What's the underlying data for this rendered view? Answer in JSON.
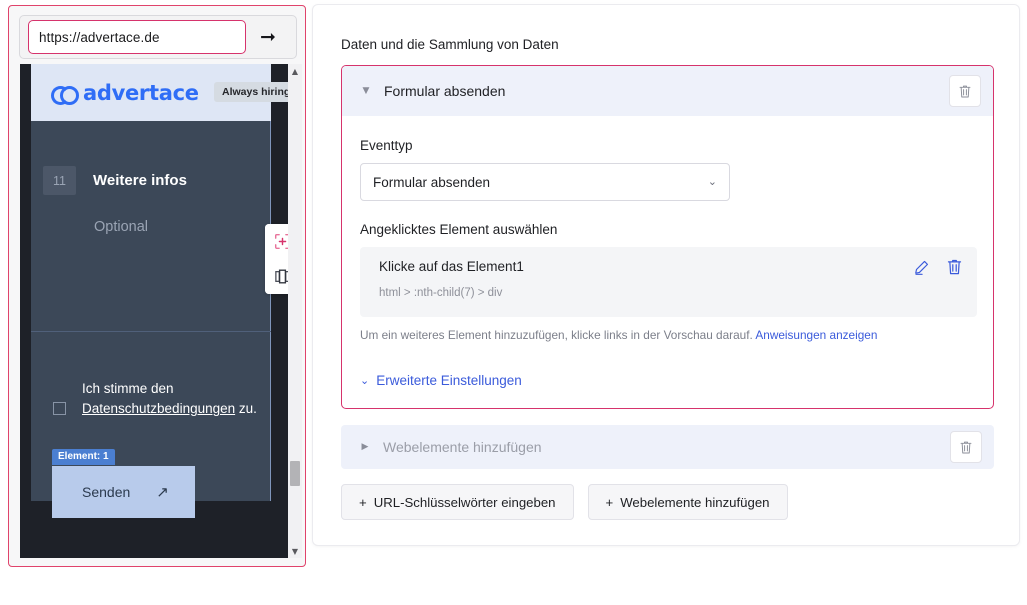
{
  "preview": {
    "url_value": "https://advertace.de",
    "url_placeholder": "https://",
    "go_icon": "arrow-right-icon",
    "site": {
      "brand": "advertace",
      "hiring_pill": "Always hiring",
      "field_number": "11",
      "field_label": "Weitere infos",
      "field_optional": "Optional",
      "consent_prefix": "Ich stimme den ",
      "consent_link": "Datenschutzbedingungen",
      "consent_suffix": " zu.",
      "element_badge": "Element: 1",
      "submit_label": "Senden",
      "submit_arrow": "↗"
    },
    "tools": {
      "select_element": "crosshair-target-icon",
      "compare_view": "split-view-icon"
    },
    "scrollbar": {
      "up": "▲",
      "down": "▼"
    }
  },
  "panel": {
    "title": "Daten und die Sammlung von Daten",
    "active_card": {
      "caret": "▼",
      "title": "Formular absenden",
      "delete_icon": "trash-icon",
      "event_type_label": "Eventtyp",
      "event_type_value": "Formular absenden",
      "event_type_chevron": "⌄",
      "element_section_label": "Angeklicktes Element auswählen",
      "element": {
        "title": "Klicke auf das Element1",
        "selector": "html > :nth-child(7) > div",
        "edit_icon": "pencil-icon",
        "delete_icon": "trash-icon"
      },
      "hint_text": "Um ein weiteres Element hinzuzufügen, klicke links in der Vorschau darauf. ",
      "hint_link": "Anweisungen anzeigen",
      "advanced_caret": "⌄",
      "advanced_label": "Erweiterte Einstellungen"
    },
    "collapsed_card": {
      "caret": "▶",
      "title": "Webelemente hinzufügen",
      "delete_icon": "trash-icon"
    },
    "buttons": [
      {
        "plus": "+",
        "label": "URL-Schlüsselwörter eingeben"
      },
      {
        "plus": "+",
        "label": "Webelemente hinzufügen"
      }
    ]
  },
  "colors": {
    "accent_pink": "#d6336c",
    "accent_blue": "#3b5bdb",
    "card_header_bg": "#eef1fa",
    "brand_blue": "#2f6df6",
    "site_bg": "#3c4858"
  }
}
